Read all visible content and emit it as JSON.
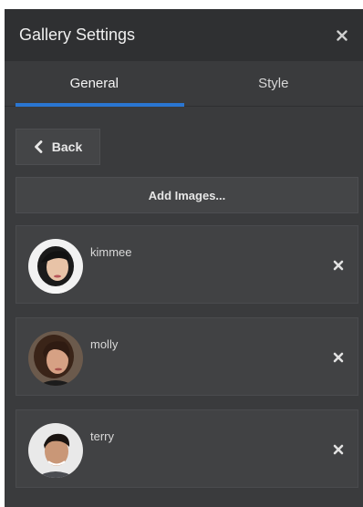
{
  "panel": {
    "title": "Gallery Settings",
    "close_icon": "close-icon"
  },
  "tabs": [
    {
      "label": "General",
      "active": true
    },
    {
      "label": "Style",
      "active": false
    }
  ],
  "back_button": {
    "label": "Back",
    "icon": "chevron-left-icon"
  },
  "add_images_button": {
    "label": "Add Images..."
  },
  "items": [
    {
      "name": "kimmee",
      "avatar": "avatar-photo",
      "remove_icon": "remove-icon"
    },
    {
      "name": "molly",
      "avatar": "avatar-photo",
      "remove_icon": "remove-icon"
    },
    {
      "name": "terry",
      "avatar": "avatar-photo",
      "remove_icon": "remove-icon"
    }
  ],
  "colors": {
    "panel_bg": "#3a3b3d",
    "titlebar_bg": "#2f3032",
    "accent": "#2a76d2"
  }
}
